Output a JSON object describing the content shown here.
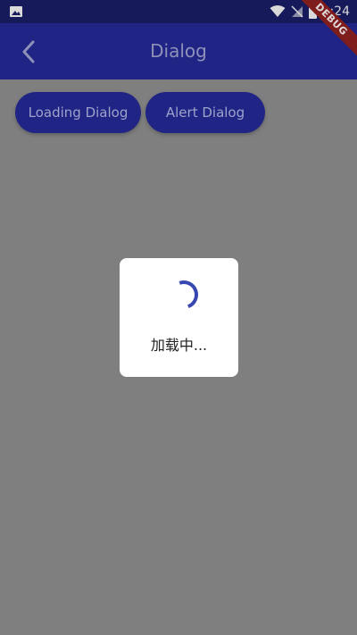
{
  "app_bar": {
    "title": "Dialog",
    "back_icon": "chevron-left-icon",
    "color": "#1f2485"
  },
  "status_bar": {
    "time": "1:24",
    "icons": [
      "image-icon",
      "wifi-icon",
      "signal-off-icon",
      "battery-icon"
    ]
  },
  "debug_banner": {
    "label": "DEBUG"
  },
  "buttons": {
    "loading": "Loading Dialog",
    "alert": "Alert Dialog"
  },
  "dialog": {
    "message": "加载中...",
    "spinner_color": "#3848b0"
  },
  "scrim_color": "#7f7f7f"
}
